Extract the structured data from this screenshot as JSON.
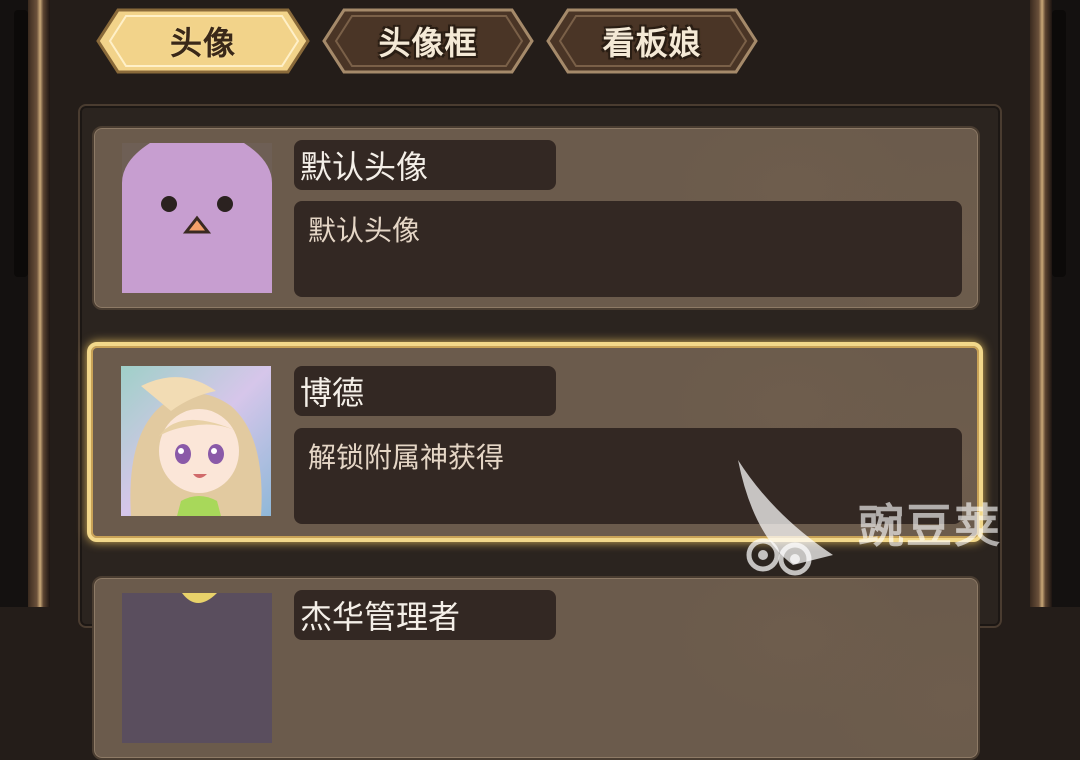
{
  "tabs": [
    {
      "label": "头像",
      "active": true
    },
    {
      "label": "头像框",
      "active": false
    },
    {
      "label": "看板娘",
      "active": false
    }
  ],
  "avatars": [
    {
      "name": "默认头像",
      "description": "默认头像",
      "icon": "default-chick-avatar",
      "selected": false
    },
    {
      "name": "博德",
      "description": "解锁附属神获得",
      "icon": "bode-character-portrait",
      "selected": true
    },
    {
      "name": "杰华管理者",
      "description": "",
      "icon": "character-portrait",
      "selected": false
    }
  ],
  "watermark": {
    "text": "豌豆荚",
    "icon": "wandoujia-logo"
  },
  "colors": {
    "tab_active": "#f2d38a",
    "tab_inactive": "#4a3526",
    "card_bg": "#6b5b4c",
    "selected_border": "#f2d88a",
    "default_avatar_bg": "#c79ed0"
  }
}
